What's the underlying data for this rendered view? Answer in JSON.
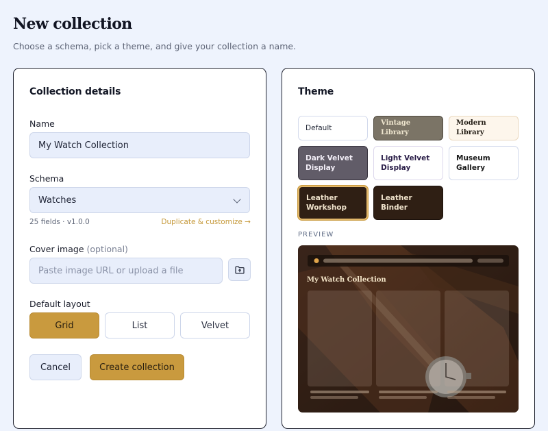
{
  "page": {
    "title": "New collection",
    "subtitle": "Choose a schema, pick a theme, and give your collection a name."
  },
  "details": {
    "title": "Collection details",
    "name_label": "Name",
    "name_value": "My Watch Collection",
    "schema_label": "Schema",
    "schema_value": "Watches",
    "schema_meta": "25 fields · v1.0.0",
    "duplicate_link": "Duplicate & customize →",
    "cover_label": "Cover image",
    "cover_optional": "(optional)",
    "cover_placeholder": "Paste image URL or upload a file",
    "layout_label": "Default layout",
    "layouts": [
      "Grid",
      "List",
      "Velvet"
    ],
    "selected_layout": "Grid",
    "cancel_label": "Cancel",
    "create_label": "Create collection"
  },
  "theme": {
    "title": "Theme",
    "options": [
      {
        "label": "Default"
      },
      {
        "label": "Vintage Library"
      },
      {
        "label": "Modern Library"
      },
      {
        "label": "Dark Velvet Display"
      },
      {
        "label": "Light Velvet Display"
      },
      {
        "label": "Museum Gallery"
      },
      {
        "label": "Leather Workshop"
      },
      {
        "label": "Leather Binder"
      }
    ],
    "selected": "Leather Workshop",
    "preview_label": "PREVIEW",
    "preview_title": "My Watch Collection"
  },
  "colors": {
    "accent": "#c99a3e",
    "panel_border": "#1c1f2c",
    "input_bg": "#e8eefb",
    "page_bg": "#eef3fd"
  },
  "icons": {
    "upload": "folder-upload-icon",
    "schema_dropdown": "chevron-down-icon"
  }
}
